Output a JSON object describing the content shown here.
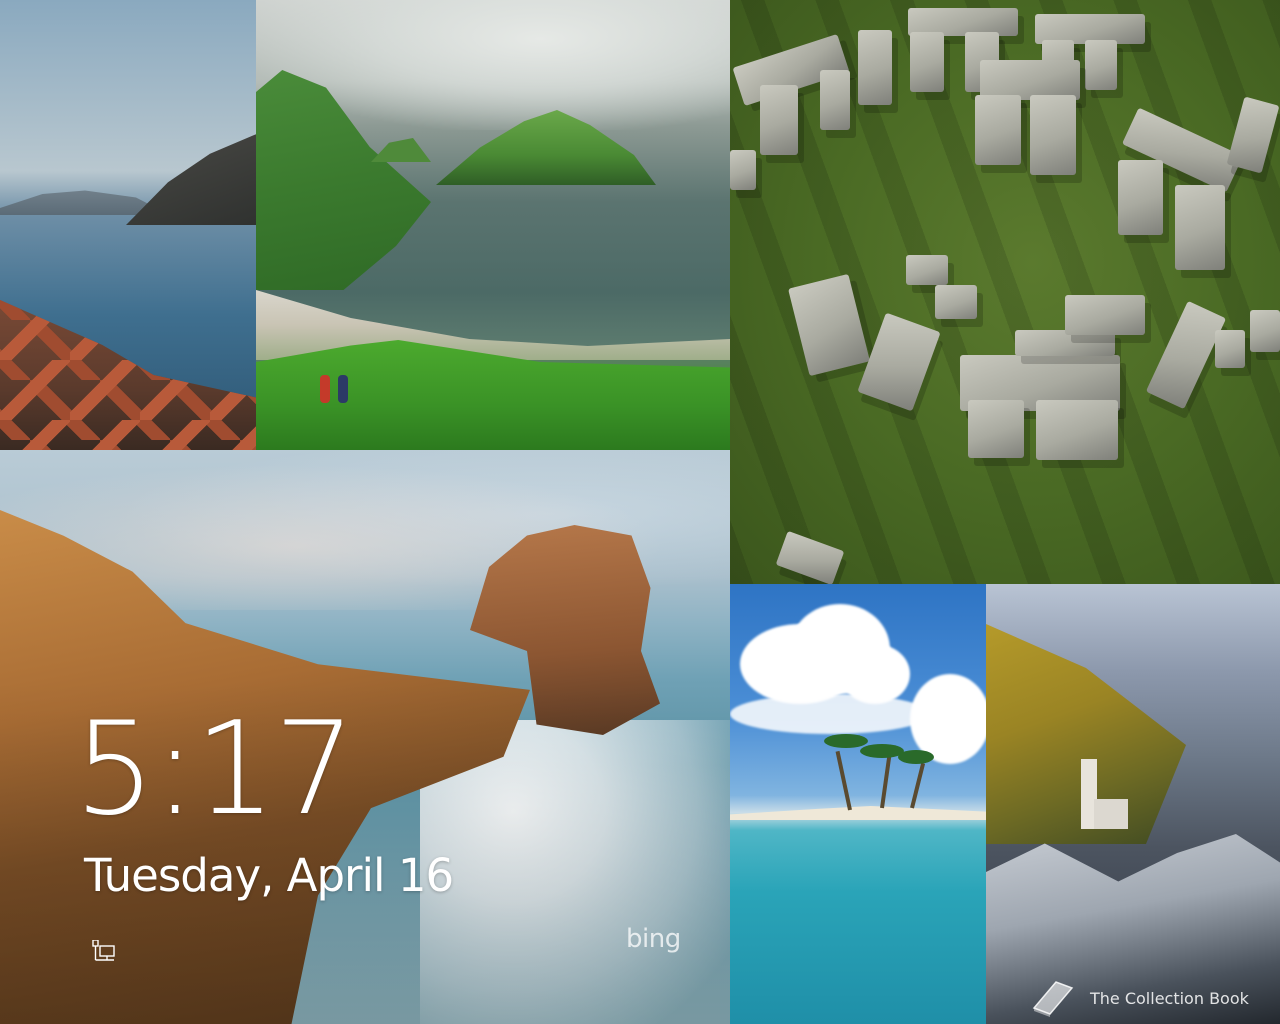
{
  "lock_screen": {
    "time": "5:17",
    "date": "Tuesday, April 16",
    "network_icon": "network-wired-icon"
  },
  "watermarks": {
    "bing_main": "bing",
    "bing_t2": "bi",
    "bing_t3": "b"
  },
  "credit": {
    "text": "The Collection Book",
    "icon": "book-icon"
  },
  "colors": {
    "text": "#ffffff"
  }
}
